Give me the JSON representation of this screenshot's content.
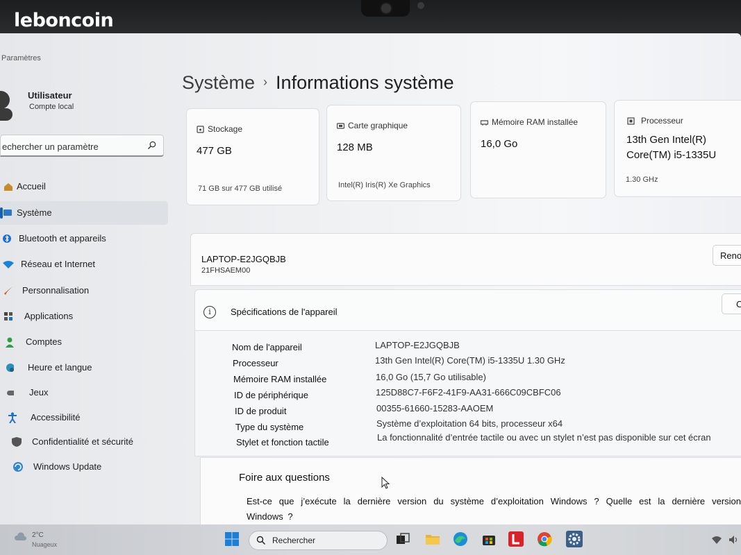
{
  "watermark": "leboncoin",
  "app": {
    "title": "Paramètres"
  },
  "user": {
    "name": "Utilisateur",
    "account": "Compte local"
  },
  "search": {
    "placeholder": "echercher un paramètre"
  },
  "nav": [
    {
      "label": "Accueil",
      "icon": "home-icon"
    },
    {
      "label": "Système",
      "icon": "monitor-icon",
      "active": true
    },
    {
      "label": "Bluetooth et appareils",
      "icon": "bluetooth-icon"
    },
    {
      "label": "Réseau et Internet",
      "icon": "wifi-icon"
    },
    {
      "label": "Personnalisation",
      "icon": "brush-icon"
    },
    {
      "label": "Applications",
      "icon": "apps-icon"
    },
    {
      "label": "Comptes",
      "icon": "person-icon"
    },
    {
      "label": "Heure et langue",
      "icon": "globe-clock-icon"
    },
    {
      "label": "Jeux",
      "icon": "gamepad-icon"
    },
    {
      "label": "Accessibilité",
      "icon": "accessibility-icon"
    },
    {
      "label": "Confidentialité et sécurité",
      "icon": "shield-icon"
    },
    {
      "label": "Windows Update",
      "icon": "update-icon"
    }
  ],
  "breadcrumb": {
    "parent": "Système",
    "separator": "›",
    "current": "Informations système"
  },
  "cards": {
    "storage": {
      "label": "Stockage",
      "value": "477 GB",
      "sub": "71 GB sur 477 GB utilisé",
      "icon": "storage-icon"
    },
    "gpu": {
      "label": "Carte graphique",
      "value": "128 MB",
      "sub": "Intel(R) Iris(R) Xe Graphics",
      "icon": "gpu-icon"
    },
    "ram": {
      "label": "Mémoire RAM installée",
      "value": "16,0 Go",
      "icon": "ram-icon"
    },
    "cpu": {
      "label": "Processeur",
      "value_line1": "13th Gen Intel(R)",
      "value_line2": "Core(TM) i5-1335U",
      "sub": "1.30 GHz",
      "icon": "cpu-icon"
    }
  },
  "device": {
    "name": "LAPTOP-E2JGQBJB",
    "model": "21FHSAEM00",
    "rename_label": "Reno"
  },
  "specs": {
    "title": "Spécifications de l'appareil",
    "copy_label": "C",
    "rows": [
      {
        "key": "Nom de l'appareil",
        "value": "LAPTOP-E2JGQBJB"
      },
      {
        "key": "Processeur",
        "value": "13th Gen Intel(R) Core(TM) i5-1335U   1.30 GHz"
      },
      {
        "key": "Mémoire RAM installée",
        "value": "16,0 Go (15,7 Go utilisable)"
      },
      {
        "key": "ID de périphérique",
        "value": "125D88C7-F6F2-41F9-AA31-666C09CBFC06"
      },
      {
        "key": "ID de produit",
        "value": "00355-61660-15283-AAOEM"
      },
      {
        "key": "Type du système",
        "value": "Système d’exploitation 64 bits, processeur x64"
      },
      {
        "key": "Stylet et fonction tactile",
        "value": "La fonctionnalité d’entrée tactile ou avec un stylet n’est pas disponible sur cet écran"
      }
    ]
  },
  "faq": {
    "title": "Foire aux questions",
    "question": "Est-ce que j’exécute la dernière version du système d’exploitation Windows ? Quelle est la dernière version Windows ?"
  },
  "taskbar": {
    "weather_temp": "2°C",
    "weather_desc": "Nuageux",
    "search_placeholder": "Rechercher",
    "apps": [
      "windows-start-icon",
      "file-explorer-icon",
      "edge-icon",
      "store-icon",
      "l-app-icon",
      "chrome-icon",
      "settings-icon"
    ]
  }
}
